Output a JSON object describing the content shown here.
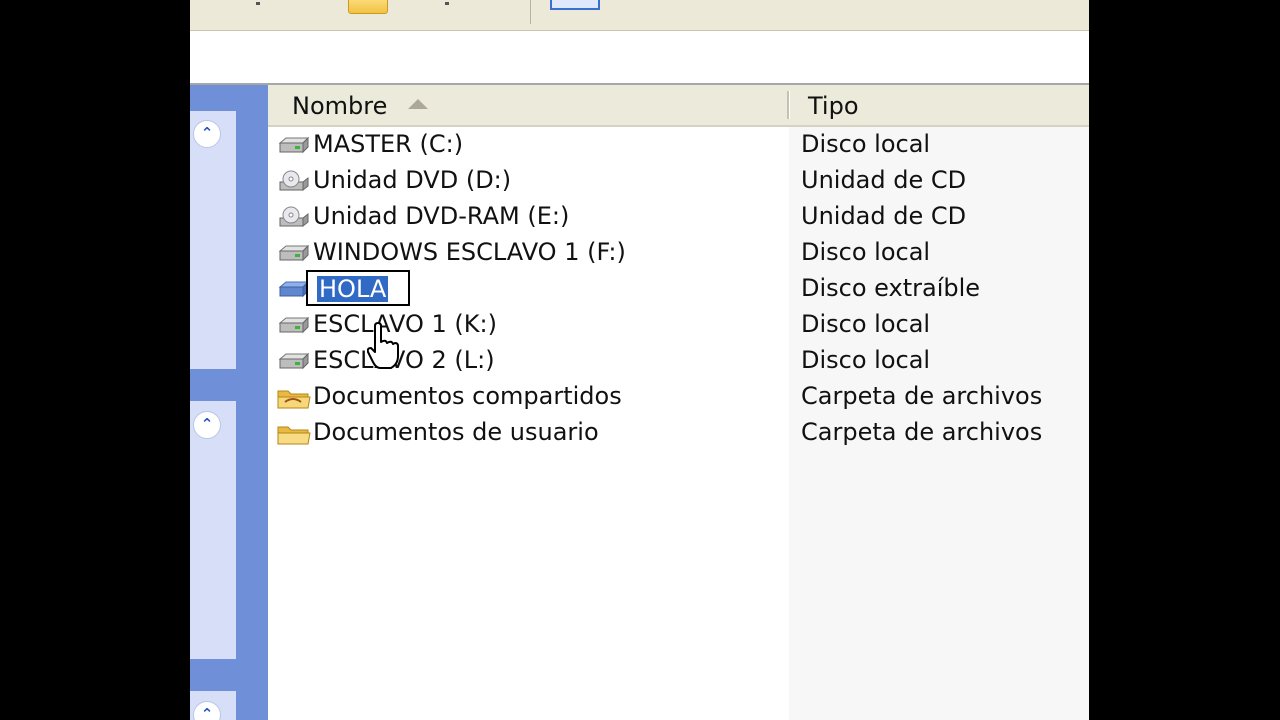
{
  "columns": {
    "name": "Nombre",
    "type": "Tipo"
  },
  "items": [
    {
      "name": "MASTER (C:)",
      "type": "Disco local",
      "icon": "hard-drive-icon"
    },
    {
      "name": "Unidad DVD (D:)",
      "type": "Unidad de CD",
      "icon": "dvd-drive-icon"
    },
    {
      "name": "Unidad DVD-RAM (E:)",
      "type": "Unidad de CD",
      "icon": "dvd-drive-icon"
    },
    {
      "name": "WINDOWS ESCLAVO 1 (F:)",
      "type": "Disco local",
      "icon": "hard-drive-icon"
    },
    {
      "name": "HOLA",
      "type": "Disco extraíble",
      "icon": "removable-drive-icon",
      "renaming": true
    },
    {
      "name": "ESCLAVO 1 (K:)",
      "type": "Disco local",
      "icon": "hard-drive-icon"
    },
    {
      "name": "ESCLAVO 2 (L:)",
      "type": "Disco local",
      "icon": "hard-drive-icon"
    },
    {
      "name": "Documentos compartidos",
      "type": "Carpeta de archivos",
      "icon": "shared-folder-icon"
    },
    {
      "name": "Documentos de usuario",
      "type": "Carpeta de archivos",
      "icon": "folder-icon"
    }
  ],
  "colors": {
    "selection": "#316ac5",
    "task_pane": "#6f8fd8",
    "header": "#ebeadb"
  }
}
